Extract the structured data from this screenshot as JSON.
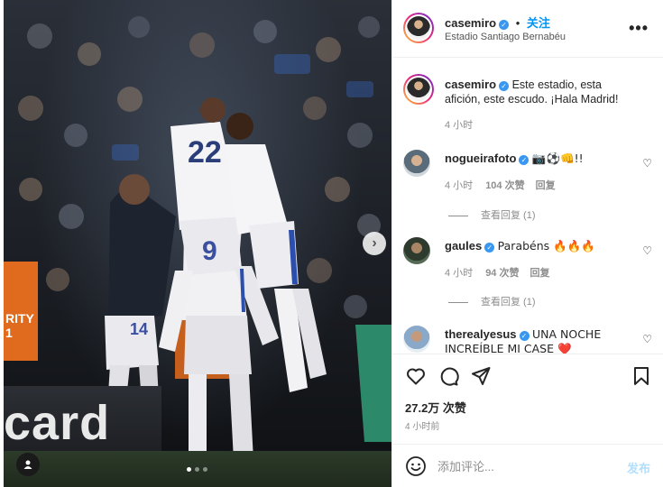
{
  "post": {
    "username": "casemiro",
    "follow_label": "关注",
    "separator": "•",
    "location": "Estadio Santiago Bernabéu",
    "more_icon": "more-horizontal-icon"
  },
  "photo": {
    "board_text": "card",
    "board_side_text": "RITY\n1",
    "jersey_top": "22",
    "jersey_mid": "9",
    "jersey_low": "14",
    "carousel_next_icon": "chevron-right-icon",
    "carousel_index": 1,
    "carousel_count": 3
  },
  "caption": {
    "username": "casemiro",
    "text": "Este estadio, esta afición, este escudo. ¡Hala Madrid!",
    "time": "4 小时"
  },
  "comments": [
    {
      "username": "nogueirafoto",
      "text": "📷⚽👊!!",
      "time": "4 小时",
      "likes": "104 次赞",
      "reply_label": "回复",
      "view_replies": "查看回复 (1)"
    },
    {
      "username": "gaules",
      "text": "Parabéns 🔥🔥🔥",
      "time": "4 小时",
      "likes": "94 次赞",
      "reply_label": "回复",
      "view_replies": "查看回复 (1)"
    },
    {
      "username": "therealyesus",
      "text": "UNA NOCHE INCREÍBLE MI CASE ❤️"
    }
  ],
  "stats": {
    "likes": "27.2万 次赞",
    "time": "4 小时前"
  },
  "composer": {
    "placeholder": "添加评论...",
    "post_label": "发布"
  },
  "colors": {
    "accent": "#0095f6",
    "verified": "#3897f0",
    "post_disabled": "#b2dffc",
    "muted": "#8e8e8e"
  }
}
